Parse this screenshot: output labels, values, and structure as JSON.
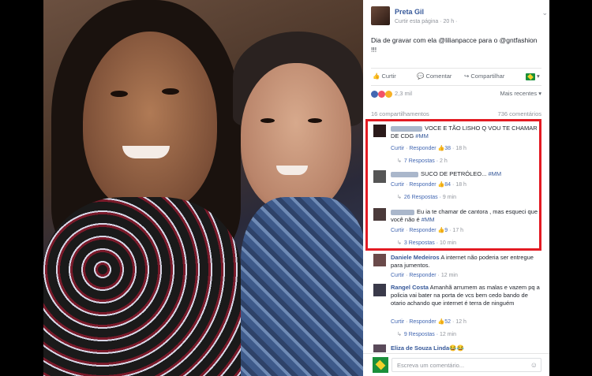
{
  "post": {
    "author": "Preta Gil",
    "meta": "Curtir esta página · 20 h ·",
    "caret": "⌄",
    "text": "Dia de gravar com ela @lilianpacce para o @gntfashion !!!"
  },
  "actions": {
    "like": "Curtir",
    "comment": "Comentar",
    "share": "Compartilhar",
    "flag_dropdown": "▾"
  },
  "reactions": {
    "count": "2,3 mil",
    "sort": "Mais recentes ▾"
  },
  "counts": {
    "shares": "16 compartilhamentos",
    "comments": "736 comentários"
  },
  "comments": [
    {
      "text": "VOCE E TÃO LISHO Q VOU TE CHAMAR DE CDG",
      "hashtag": "#MM",
      "like": "Curtir",
      "reply": "Responder",
      "likes": "38",
      "time": "18 h",
      "replies": "7 Respostas",
      "replies_time": "2 h"
    },
    {
      "text": "SUCO DE PETRÓLEO...",
      "hashtag": "#MM",
      "like": "Curtir",
      "reply": "Responder",
      "likes": "84",
      "time": "18 h",
      "replies": "26 Respostas",
      "replies_time": "9 min"
    },
    {
      "text": "Eu ia te chamar de cantora , mas esqueci que você não é",
      "hashtag": "#MM",
      "like": "Curtir",
      "reply": "Responder",
      "likes": "9",
      "time": "17 h",
      "replies": "3 Respostas",
      "replies_time": "10 min"
    },
    {
      "name": "Daniele Medeiros",
      "text": "A internet não poderia ser entregue para jumentos.",
      "like": "Curtir",
      "reply": "Responder",
      "time": "12 min"
    },
    {
      "name": "Rangel Costa",
      "text": "Amanhã arrumem as malas e vazem pq a policia vai bater na porta de vcs bem cedo bando de otario achando que internet é terra de ninguém",
      "like": "Curtir",
      "reply": "Responder",
      "likes": "52",
      "time": "12 h",
      "replies": "9 Respostas",
      "replies_time": "12 min"
    },
    {
      "name": "Eliza de Souza Linda",
      "text": "😂😂"
    }
  ],
  "composer": {
    "placeholder": "Escreva um comentário...",
    "camera_icon": "☺"
  },
  "colors": {
    "link": "#365899",
    "highlight": "#e31b23",
    "meta": "#90949c"
  }
}
